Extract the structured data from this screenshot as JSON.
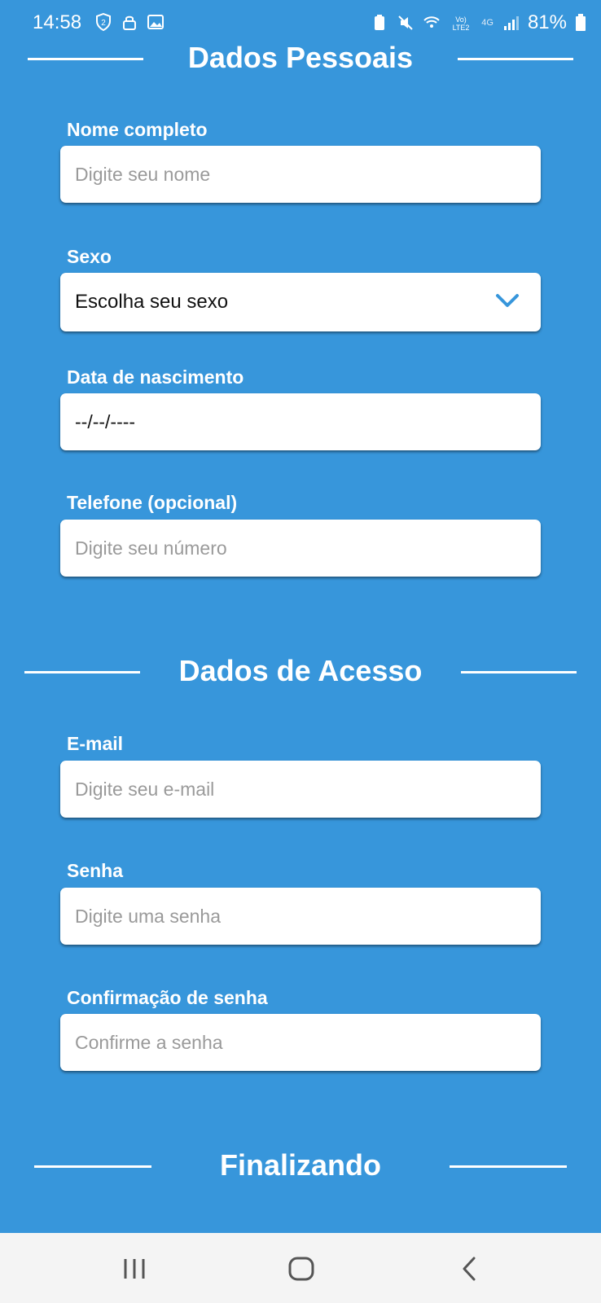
{
  "status_bar": {
    "time": "14:58",
    "battery": "81%",
    "network": "4G"
  },
  "sections": {
    "personal": {
      "title": "Dados Pessoais"
    },
    "access": {
      "title": "Dados de Acesso"
    },
    "final": {
      "title": "Finalizando"
    }
  },
  "fields": {
    "name": {
      "label": "Nome completo",
      "placeholder": "Digite seu nome",
      "value": ""
    },
    "sex": {
      "label": "Sexo",
      "value": "Escolha seu sexo"
    },
    "birthdate": {
      "label": "Data de nascimento",
      "value": "--/--/----"
    },
    "phone": {
      "label": "Telefone (opcional)",
      "placeholder": "Digite seu número",
      "value": ""
    },
    "email": {
      "label": "E-mail",
      "placeholder": "Digite seu e-mail",
      "value": ""
    },
    "password": {
      "label": "Senha",
      "placeholder": "Digite uma senha",
      "value": ""
    },
    "password_confirm": {
      "label": "Confirmação de senha",
      "placeholder": "Confirme a senha",
      "value": ""
    }
  },
  "colors": {
    "background": "#3796db",
    "accent": "#3796db",
    "field_bg": "#ffffff"
  },
  "icons": {
    "chevron": "chevron-down-icon"
  }
}
